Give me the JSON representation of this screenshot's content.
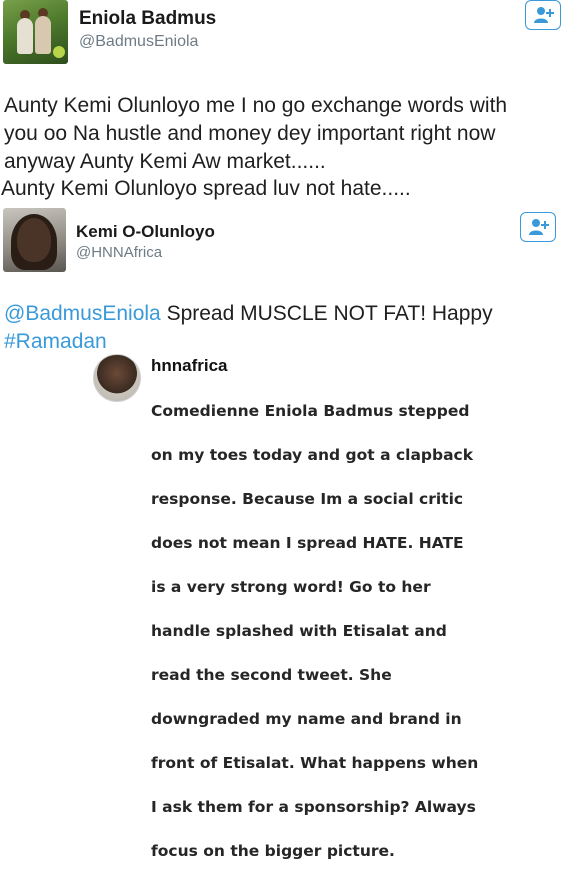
{
  "tweet1": {
    "display_name": "Eniola Badmus",
    "handle": "@BadmusEniola",
    "text_line1": "Aunty Kemi Olunloyo me I no go exchange words with",
    "text_line2": "you oo Na hustle and money dey important right now",
    "text_line3": "anyway Aunty Kemi Aw market......",
    "text_line4": "Aunty Kemi Olunloyo spread luv not hate.....",
    "avatar_icon": "profile-photo-icon"
  },
  "tweet2": {
    "display_name": "Kemi O-Olunloyo",
    "handle": "@HNNAfrica",
    "mention": "@BadmusEniola",
    "text_rest": " Spread MUSCLE NOT FAT! Happy",
    "hashtag": "#Ramadan",
    "avatar_icon": "profile-photo-icon"
  },
  "instagram_post": {
    "username": "hnnafrica",
    "caption_lines": [
      "Comedienne Eniola Badmus stepped",
      "on my toes today and got a clapback",
      "response. Because Im a social critic",
      "does not mean I spread HATE. HATE",
      "is a very strong word! Go to her",
      "handle splashed with Etisalat and",
      "read the second tweet. She",
      "downgraded my name and brand in",
      "front of Etisalat. What happens when",
      "I ask them for a sponsorship? Always",
      "focus on the bigger picture."
    ]
  },
  "colors": {
    "link": "#3a9ad9",
    "handle_gray": "#6e7b85",
    "text": "#1f1f1f"
  },
  "icons": {
    "follow": "add-user-icon"
  }
}
